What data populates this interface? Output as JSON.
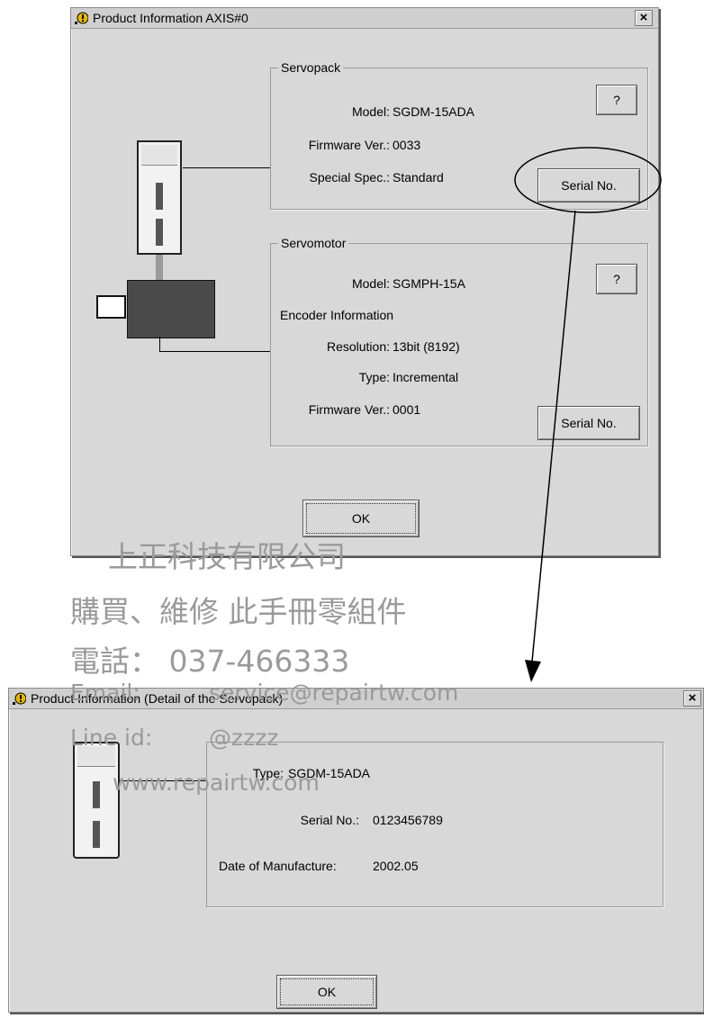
{
  "top_dialog": {
    "title": "Product Information AXIS#0",
    "close_label": "×",
    "servopack": {
      "legend": "Servopack",
      "model_label": "Model:",
      "model_value": "SGDM-15ADA",
      "firmware_label": "Firmware Ver.:",
      "firmware_value": "0033",
      "special_label": "Special Spec.:",
      "special_value": "Standard",
      "help_label": "?",
      "serial_button": "Serial No."
    },
    "servomotor": {
      "legend": "Servomotor",
      "model_label": "Model:",
      "model_value": "SGMPH-15A",
      "encoder_label": "Encoder Information",
      "resolution_label": "Resolution:",
      "resolution_value": "13bit (8192)",
      "type_label": "Type:",
      "type_value": "Incremental",
      "firmware_label": "Firmware Ver.:",
      "firmware_value": "0001",
      "help_label": "?",
      "serial_button": "Serial No."
    },
    "ok_button": "OK"
  },
  "detail_dialog": {
    "title": "Product Information (Detail of the Servopack)",
    "close_label": "×",
    "type_label": "Type:",
    "type_value": "SGDM-15ADA",
    "serial_label": "Serial No.:",
    "serial_value": "0123456789",
    "date_label": "Date of Manufacture:",
    "date_value": "2002.05",
    "ok_button": "OK"
  },
  "watermark": {
    "line1": "上正科技有限公司",
    "line2": "購買、維修 此手冊零組件",
    "line3": "電話：   037-466333",
    "line4_label": "Email:",
    "line4_value": "service@repairtw.com",
    "line5_label": "Line id:",
    "line5_value": "@zzzz",
    "line6": "www.repairtw.com"
  },
  "colors": {
    "dialog_bg": "#d8d8d8",
    "watermark": "#9a9a9a"
  }
}
